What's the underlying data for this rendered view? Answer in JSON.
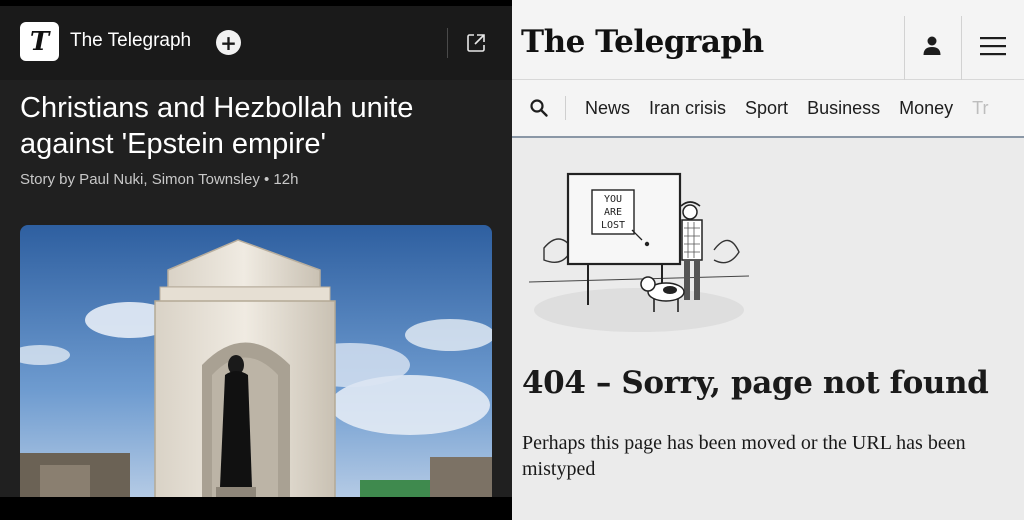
{
  "article_view": {
    "publisher": {
      "logo_glyph": "T",
      "name": "The Telegraph",
      "follow_symbol": "+"
    },
    "headline": "Christians and Hezbollah unite against 'Epstein empire'",
    "byline": "Story by Paul Nuki, Simon Townsley • 12h",
    "hero_image_alt": "Statue of a woman in a stone shrine against a blue sky"
  },
  "telegraph_site": {
    "logo_text": "The Telegraph",
    "nav_items": [
      "News",
      "Iran crisis",
      "Sport",
      "Business",
      "Money"
    ],
    "nav_overflow_item": "Tr",
    "cartoon_sign_lines": [
      "YOU",
      "ARE",
      "LOST"
    ],
    "error_title": "404 – Sorry, page not found",
    "error_message": "Perhaps this page has been moved or the URL has been mistyped"
  },
  "colors": {
    "left_background": "#202020",
    "right_background": "#ebebeb",
    "nav_underline": "#8a97a6"
  }
}
